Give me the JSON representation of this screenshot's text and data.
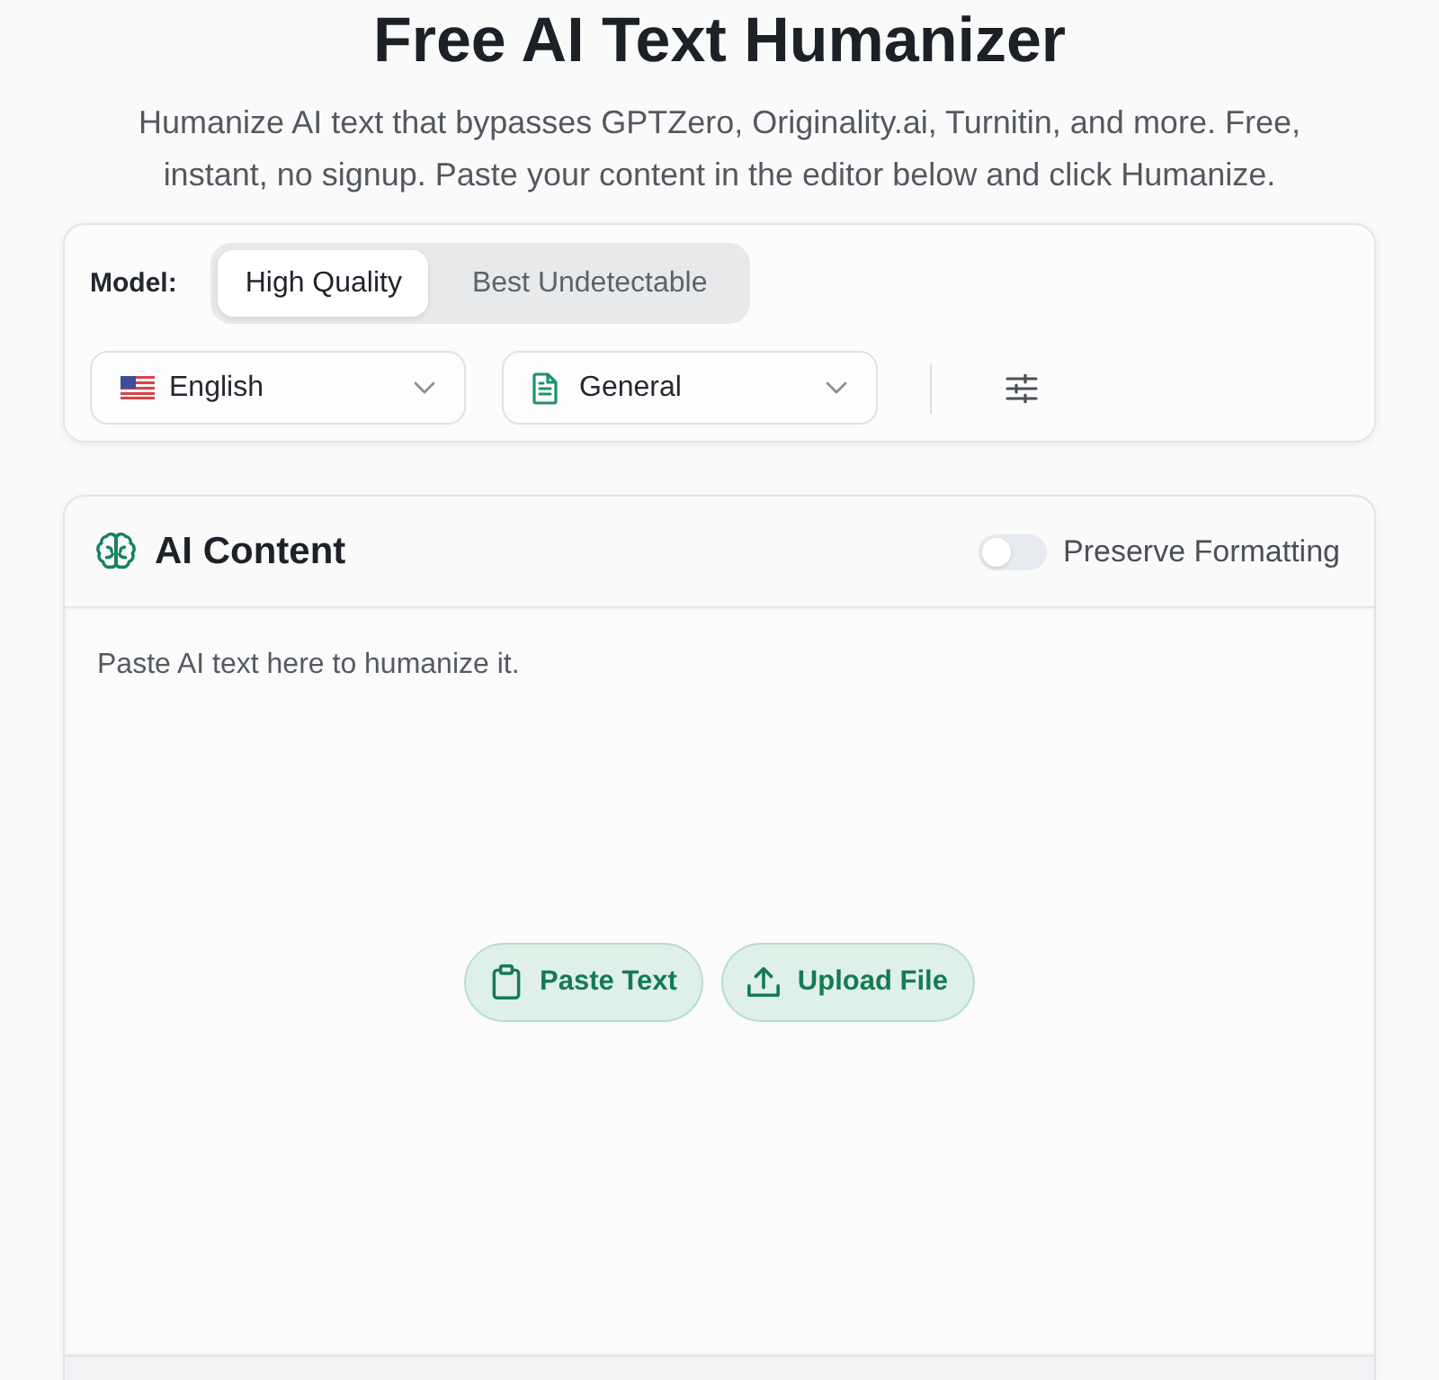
{
  "header": {
    "title": "Free AI Text Humanizer",
    "subtitle": "Humanize AI text that bypasses GPTZero, Originality.ai, Turnitin, and more. Free, instant, no signup. Paste your content in the editor below and click Humanize."
  },
  "options": {
    "model_label": "Model:",
    "models": [
      {
        "label": "High Quality",
        "selected": true
      },
      {
        "label": "Best Undetectable",
        "selected": false
      }
    ],
    "selects": [
      {
        "kind": "language",
        "value": "English"
      },
      {
        "kind": "document",
        "value": "General"
      }
    ]
  },
  "editor": {
    "title": "AI Content",
    "toggle": {
      "label": "Preserve Formatting",
      "on": false
    },
    "placeholder": "Paste AI text here to humanize it.",
    "actions": [
      {
        "kind": "paste",
        "label": "Paste Text"
      },
      {
        "kind": "upload",
        "label": "Upload File"
      }
    ]
  }
}
